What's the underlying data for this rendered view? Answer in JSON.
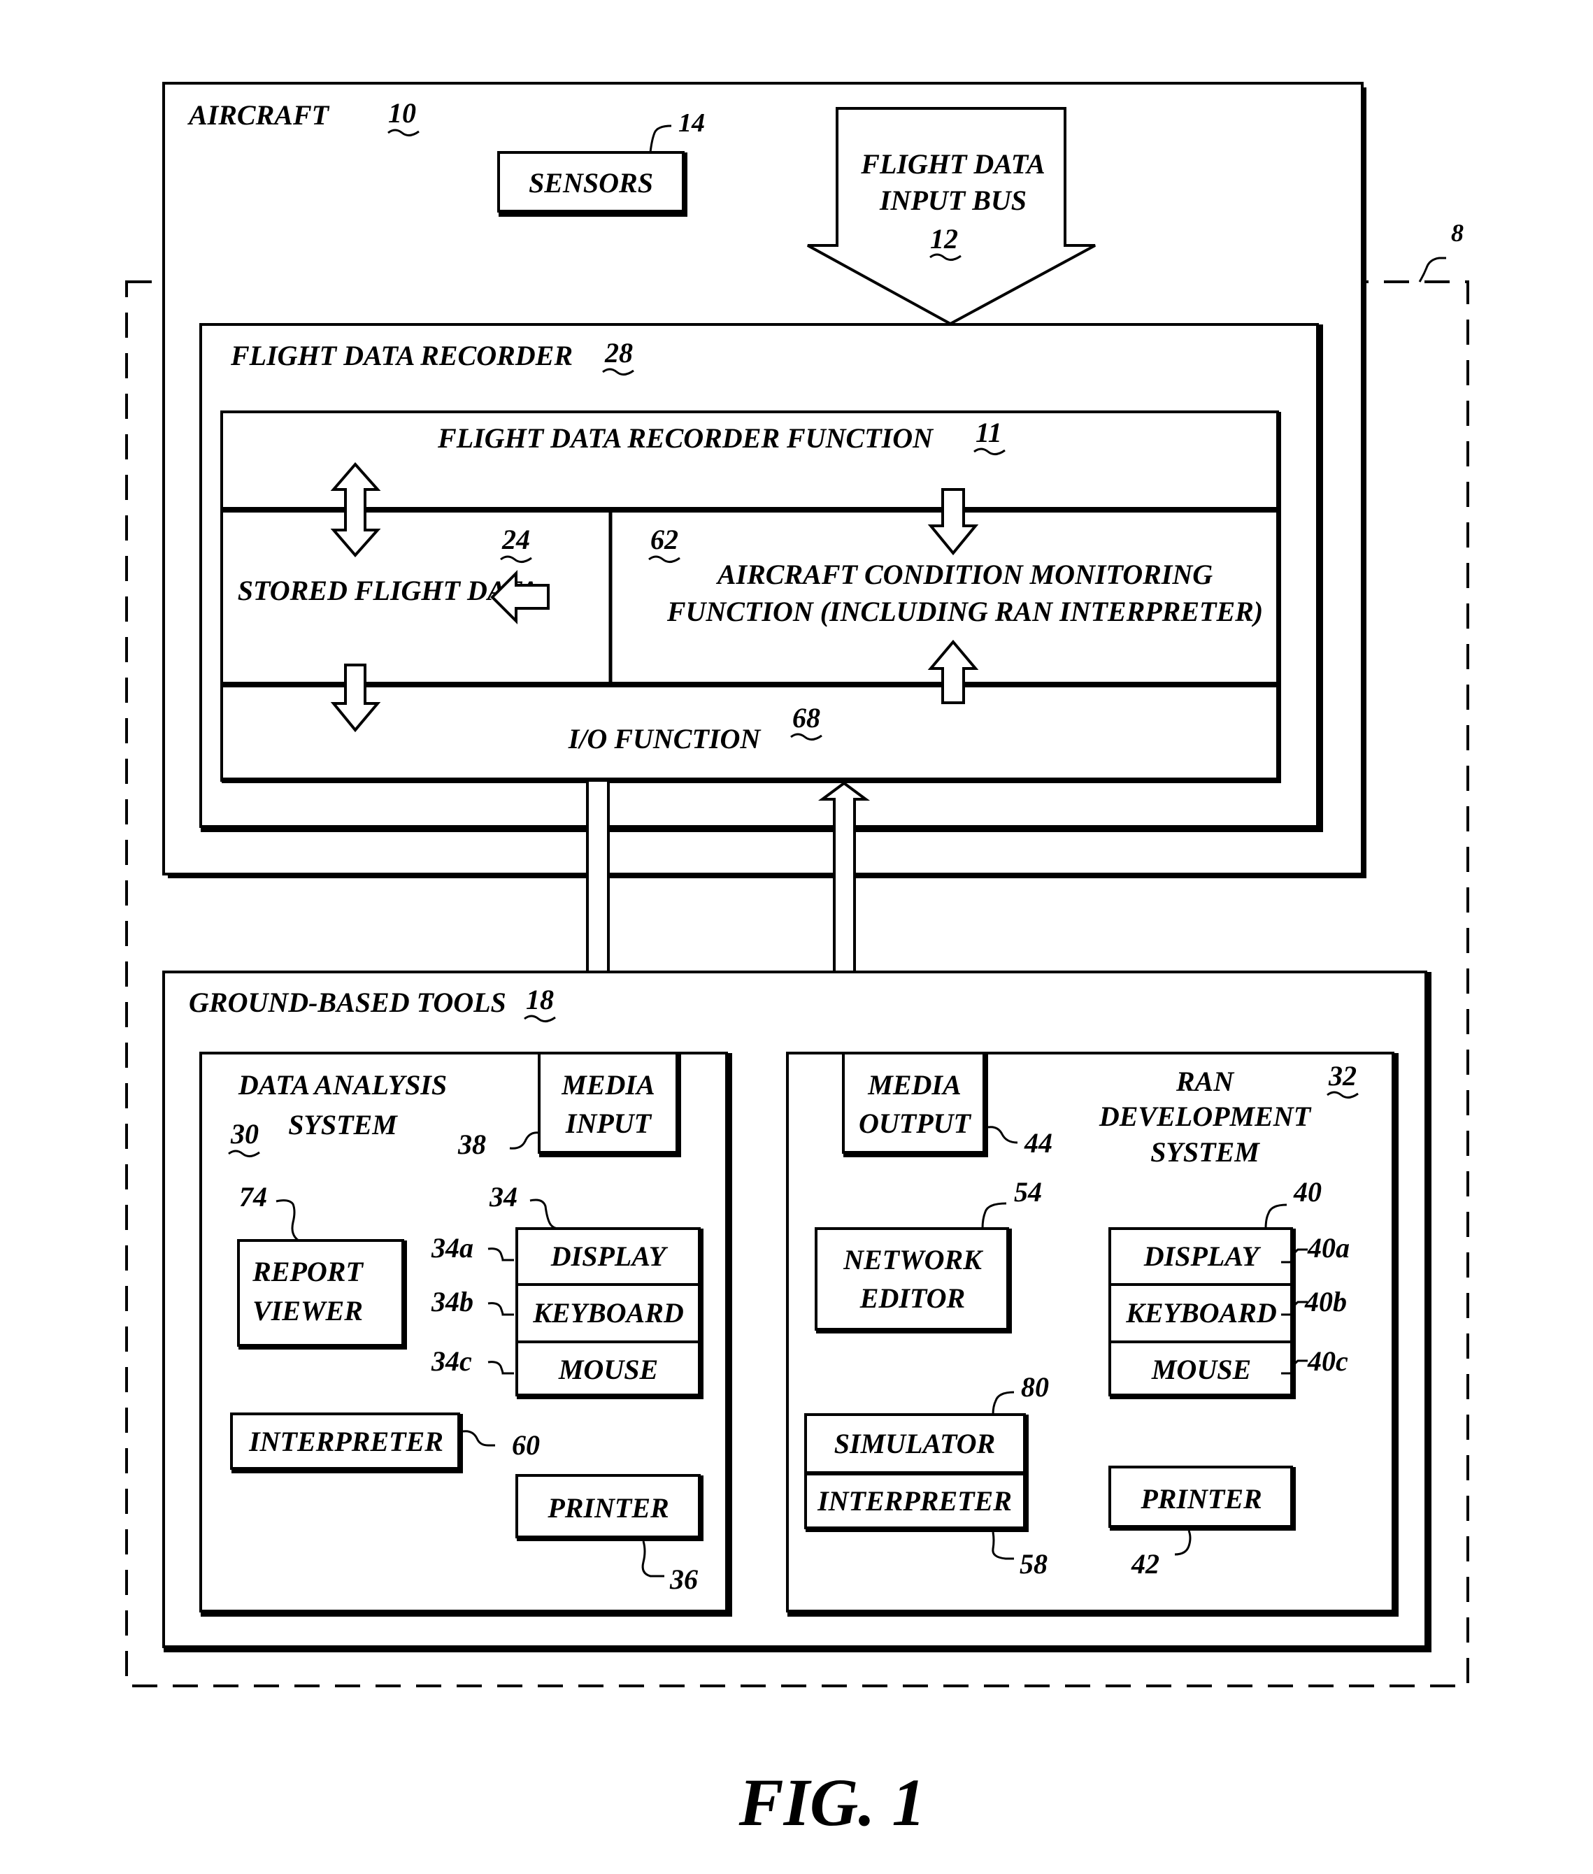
{
  "figure": {
    "caption": "FIG. 1",
    "system_ref": "8"
  },
  "aircraft": {
    "title": "AIRCRAFT",
    "ref": "10",
    "sensors": {
      "label": "SENSORS",
      "ref": "14"
    },
    "flight_data_input_bus": {
      "line1": "FLIGHT DATA",
      "line2": "INPUT BUS",
      "ref": "12"
    }
  },
  "flight_data_recorder": {
    "title": "FLIGHT DATA RECORDER",
    "ref": "28",
    "function": {
      "label": "FLIGHT DATA RECORDER FUNCTION",
      "ref": "11"
    },
    "stored_flight_data": {
      "label": "STORED FLIGHT DATA",
      "ref": "24"
    },
    "acm_function": {
      "line1": "AIRCRAFT CONDITION  MONITORING",
      "line2": "FUNCTION (INCLUDING RAN INTERPRETER)",
      "ref": "62"
    },
    "io_function": {
      "label": "I/O FUNCTION",
      "ref": "68"
    }
  },
  "ground_tools": {
    "title": "GROUND-BASED TOOLS",
    "ref": "18",
    "data_analysis": {
      "line1": "DATA ANALYSIS",
      "line2": "SYSTEM",
      "ref": "30",
      "media_input": {
        "line1": "MEDIA",
        "line2": "INPUT",
        "ref": "38"
      },
      "report_viewer": {
        "line1": "REPORT",
        "line2": "VIEWER",
        "ref": "74"
      },
      "io_stack": {
        "ref": "34",
        "display": "DISPLAY",
        "display_ref": "34a",
        "keyboard": "KEYBOARD",
        "keyboard_ref": "34b",
        "mouse": "MOUSE",
        "mouse_ref": "34c"
      },
      "interpreter": {
        "label": "INTERPRETER",
        "ref": "60"
      },
      "printer": {
        "label": "PRINTER",
        "ref": "36"
      }
    },
    "ran_development": {
      "line1": "RAN",
      "line2": "DEVELOPMENT",
      "line3": "SYSTEM",
      "ref": "32",
      "media_output": {
        "line1": "MEDIA",
        "line2": "OUTPUT",
        "ref": "44"
      },
      "network_editor": {
        "line1": "NETWORK",
        "line2": "EDITOR",
        "ref": "54"
      },
      "io_stack": {
        "ref": "40",
        "display": "DISPLAY",
        "display_ref": "40a",
        "keyboard": "KEYBOARD",
        "keyboard_ref": "40b",
        "mouse": "MOUSE",
        "mouse_ref": "40c"
      },
      "simulator": {
        "label": "SIMULATOR",
        "ref": "80"
      },
      "interpreter": {
        "label": "INTERPRETER",
        "ref": "58"
      },
      "printer": {
        "label": "PRINTER",
        "ref": "42"
      }
    }
  }
}
